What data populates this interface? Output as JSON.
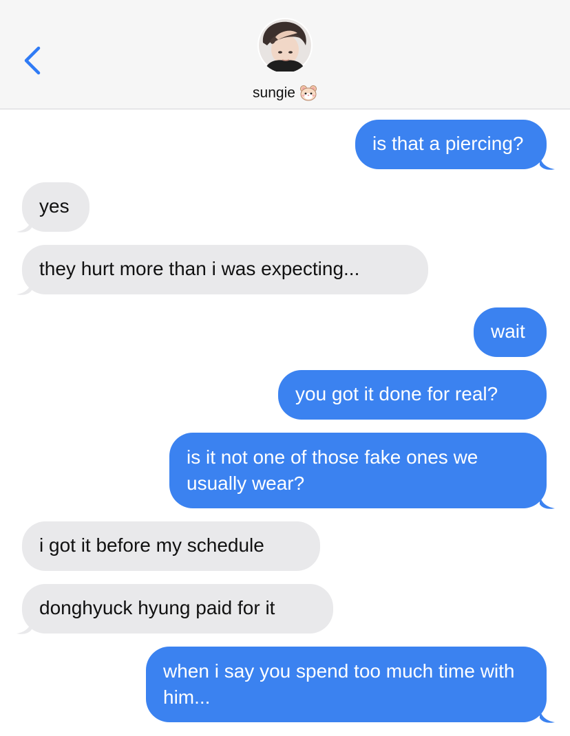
{
  "header": {
    "contact_name": "sungie",
    "back_icon": "chevron-left-icon",
    "contact_emoji_icon": "hamster-face-icon"
  },
  "colors": {
    "sent_bubble": "#3b82f0",
    "received_bubble": "#e9e9eb",
    "accent": "#2f7bf5"
  },
  "messages": [
    {
      "direction": "sent",
      "text": "is that a piercing?"
    },
    {
      "direction": "received",
      "text": "yes"
    },
    {
      "direction": "received",
      "text": "they hurt more than i was expecting..."
    },
    {
      "direction": "sent",
      "text": "wait"
    },
    {
      "direction": "sent",
      "text": "you got it done for real?"
    },
    {
      "direction": "sent",
      "text": "is it not one of those fake ones we usually wear?"
    },
    {
      "direction": "received",
      "text": "i got it before my schedule"
    },
    {
      "direction": "received",
      "text": "donghyuck hyung paid for it"
    },
    {
      "direction": "sent",
      "text": "when i say you spend too much time with him..."
    }
  ]
}
